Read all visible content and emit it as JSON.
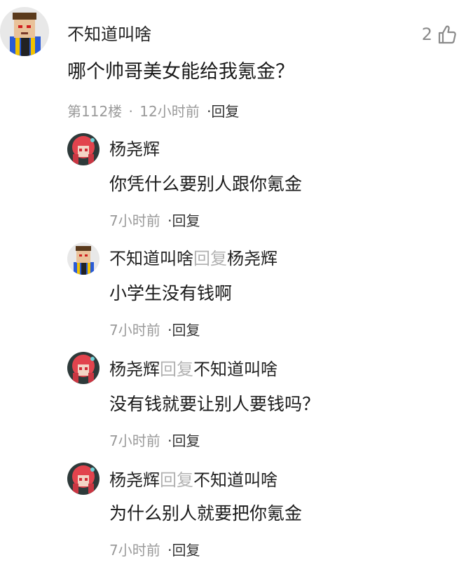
{
  "main_comment": {
    "username": "不知道叫啥",
    "content": "哪个帅哥美女能给我氪金？",
    "floor": "第112楼",
    "separator": "·",
    "time": "12小时前",
    "reply_label": "·回复",
    "like_count": "2",
    "like_icon": "thumbs-up-icon"
  },
  "replies": [
    {
      "username": "杨尧辉",
      "reply_word": "",
      "reply_to": "",
      "content": "你凭什么要别人跟你氪金",
      "time": "7小时前",
      "reply_label": "·回复"
    },
    {
      "username": "不知道叫啥",
      "reply_word": "回复",
      "reply_to": "杨尧辉",
      "content": "小学生没有钱啊",
      "time": "7小时前",
      "reply_label": "·回复"
    },
    {
      "username": "杨尧辉",
      "reply_word": "回复",
      "reply_to": "不知道叫啥",
      "content": "没有钱就要让别人要钱吗？",
      "time": "7小时前",
      "reply_label": "·回复"
    },
    {
      "username": "杨尧辉",
      "reply_word": "回复",
      "reply_to": "不知道叫啥",
      "content": "为什么别人就要把你氪金",
      "time": "7小时前",
      "reply_label": "·回复"
    }
  ],
  "colors": {
    "meta_gray": "#9a9a9a",
    "reply_word_gray": "#b2b2b2",
    "text": "#1a1a1a"
  }
}
